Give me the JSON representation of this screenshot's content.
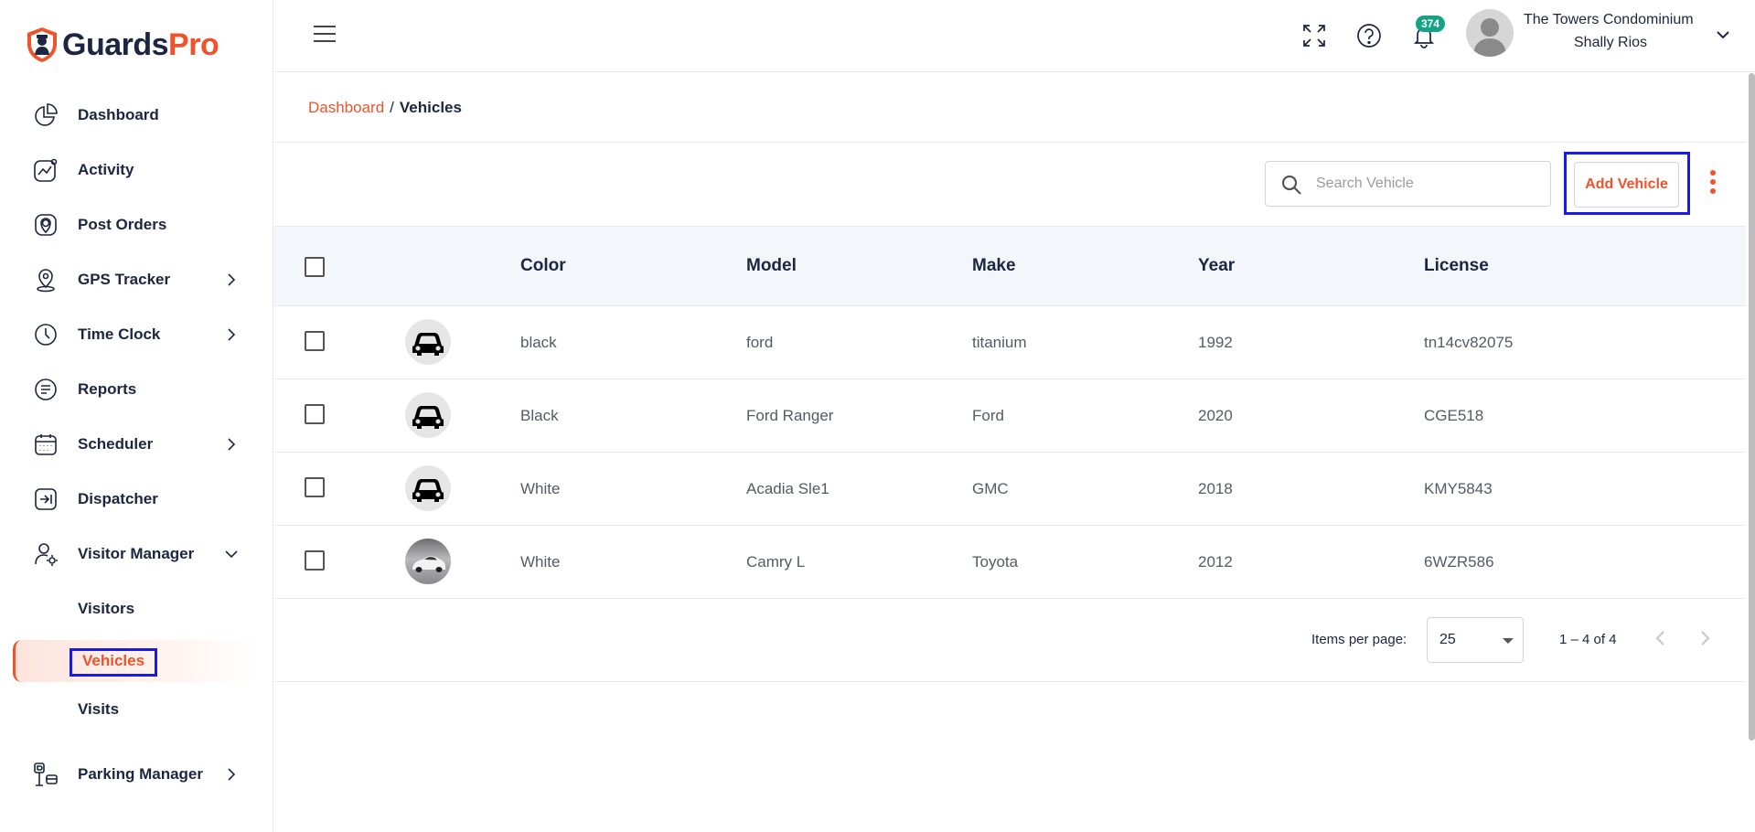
{
  "brand": {
    "name_part1": "Guards",
    "name_part2": "Pro",
    "accent_color": "#f0532b",
    "navy_color": "#1c2541"
  },
  "sidebar": {
    "items": [
      {
        "label": "Dashboard",
        "icon": "pie-chart-icon"
      },
      {
        "label": "Activity",
        "icon": "activity-icon"
      },
      {
        "label": "Post Orders",
        "icon": "post-orders-icon"
      },
      {
        "label": "GPS Tracker",
        "icon": "map-pin-icon"
      },
      {
        "label": "Time Clock",
        "icon": "clock-icon"
      },
      {
        "label": "Reports",
        "icon": "report-icon"
      },
      {
        "label": "Scheduler",
        "icon": "calendar-icon"
      },
      {
        "label": "Dispatcher",
        "icon": "dispatch-icon"
      },
      {
        "label": "Visitor Manager",
        "icon": "visitor-icon"
      },
      {
        "label": "Parking Manager",
        "icon": "parking-icon"
      }
    ],
    "visitor_sub": [
      {
        "label": "Visitors"
      },
      {
        "label": "Vehicles"
      },
      {
        "label": "Visits"
      }
    ]
  },
  "header": {
    "notification_count": "374",
    "user_org": "The Towers Condominium",
    "user_name": "Shally Rios"
  },
  "breadcrumb": {
    "root": "Dashboard",
    "separator": "/",
    "current": "Vehicles"
  },
  "toolbar": {
    "search_placeholder": "Search Vehicle",
    "add_label": "Add Vehicle"
  },
  "table": {
    "columns": [
      "Color",
      "Model",
      "Make",
      "Year",
      "License"
    ],
    "rows": [
      {
        "color": "black",
        "model": "ford",
        "make": "titanium",
        "year": "1992",
        "license": "tn14cv82075",
        "image": "car-icon"
      },
      {
        "color": "Black",
        "model": "Ford Ranger",
        "make": "Ford",
        "year": "2020",
        "license": "CGE518",
        "image": "car-icon"
      },
      {
        "color": "White",
        "model": "Acadia Sle1",
        "make": "GMC",
        "year": "2018",
        "license": "KMY5843",
        "image": "car-icon"
      },
      {
        "color": "White",
        "model": "Camry L",
        "make": "Toyota",
        "year": "2012",
        "license": "6WZR586",
        "image": "car-photo"
      }
    ]
  },
  "pagination": {
    "items_per_page_label": "Items per page:",
    "items_per_page": "25",
    "range": "1 – 4 of 4"
  }
}
